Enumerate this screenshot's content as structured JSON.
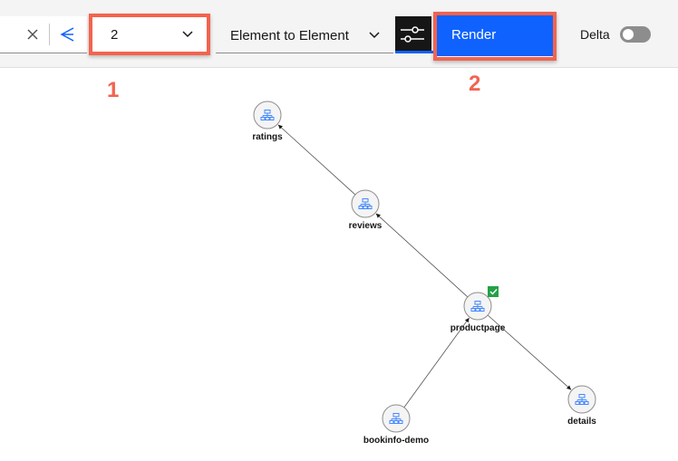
{
  "toolbar": {
    "hops_value": "2",
    "relation_type": "Element to Element",
    "render_label": "Render",
    "delta_label": "Delta",
    "delta_enabled": false
  },
  "callouts": {
    "first": "1",
    "second": "2"
  },
  "graph": {
    "nodes": [
      {
        "id": "ratings",
        "label": "ratings"
      },
      {
        "id": "reviews",
        "label": "reviews"
      },
      {
        "id": "productpage",
        "label": "productpage",
        "status": "ok"
      },
      {
        "id": "details",
        "label": "details"
      },
      {
        "id": "bookinfo-demo",
        "label": "bookinfo-demo"
      }
    ],
    "edges": [
      {
        "from": "reviews",
        "to": "ratings"
      },
      {
        "from": "productpage",
        "to": "reviews"
      },
      {
        "from": "productpage",
        "to": "details"
      },
      {
        "from": "bookinfo-demo",
        "to": "productpage"
      }
    ]
  },
  "colors": {
    "primary_blue": "#0f62fe",
    "callout_red": "#f2634f",
    "status_green": "#24a148",
    "node_icon_blue": "#4589ff"
  },
  "icons": {
    "clear": "close-icon",
    "topology": "topology-icon",
    "dropdown": "chevron-down-icon",
    "settings": "sliders-icon",
    "node": "hierarchy-icon",
    "status": "checkmark-icon"
  }
}
